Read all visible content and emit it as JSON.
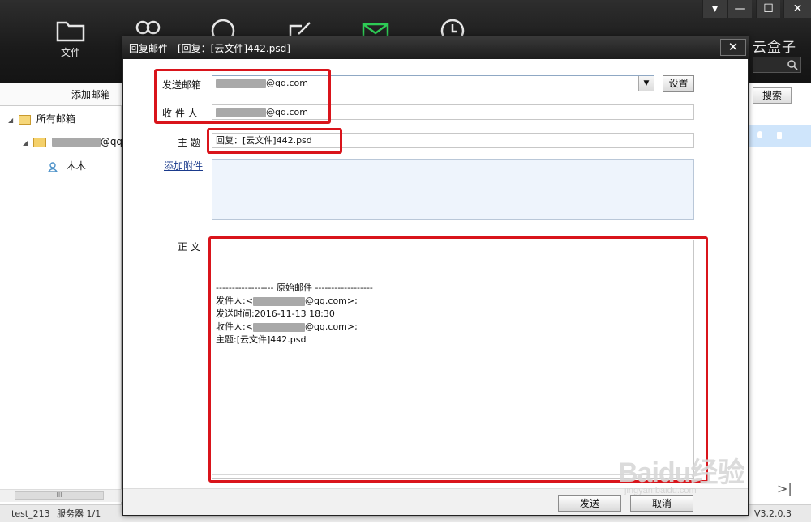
{
  "app": {
    "nav": [
      {
        "label": "文件",
        "icon": "folder-icon"
      },
      {
        "label": "",
        "icon": "contacts-icon"
      },
      {
        "label": "",
        "icon": "chat-icon"
      },
      {
        "label": "",
        "icon": "edit-icon"
      },
      {
        "label": "",
        "icon": "mail-icon"
      },
      {
        "label": "",
        "icon": "clock-icon"
      }
    ],
    "window_controls": {
      "menu": "▾",
      "minimize": "—",
      "maximize": "☐",
      "close": "✕"
    },
    "brand": "云盒子",
    "search_button": "搜索",
    "sidebar": {
      "header": "添加邮箱",
      "all_mail": "所有邮箱",
      "account_suffix": "@qq.c",
      "contact": "木木",
      "scroll_grip": "III"
    },
    "status": {
      "user": "test_213",
      "server": "服务器 1/1",
      "version": "V3.2.0.3"
    }
  },
  "dialog": {
    "title": "回复邮件 - [回复：[云文件]442.psd]",
    "close": "✕",
    "from_label": "发送邮箱",
    "from_suffix": "@qq.com",
    "dropdown_arrow": "▼",
    "settings_button": "设置",
    "to_label": "收 件 人",
    "to_suffix": "@qq.com",
    "subject_label": "主  题",
    "subject_value": "回复：[云文件]442.psd",
    "attach_link": "添加附件",
    "body_label": "正  文",
    "body": {
      "separator": "------------------ 原始邮件 ------------------",
      "from_prefix": "发件人:<",
      "from_suffix": "@qq.com>;",
      "sent_time": "发送时间:2016-11-13 18:30",
      "to_prefix": "收件人:<",
      "to_suffix": "@qq.com>;",
      "subject": "主题:[云文件]442.psd"
    },
    "send_button": "发送",
    "cancel_button": "取消"
  },
  "watermark": {
    "main": "Baidu经验",
    "sub": "jingyan.baidu.com"
  },
  "colors": {
    "highlight": "#d9141b",
    "topbar": "#1f1f1f",
    "selection": "#cfe5fb"
  }
}
